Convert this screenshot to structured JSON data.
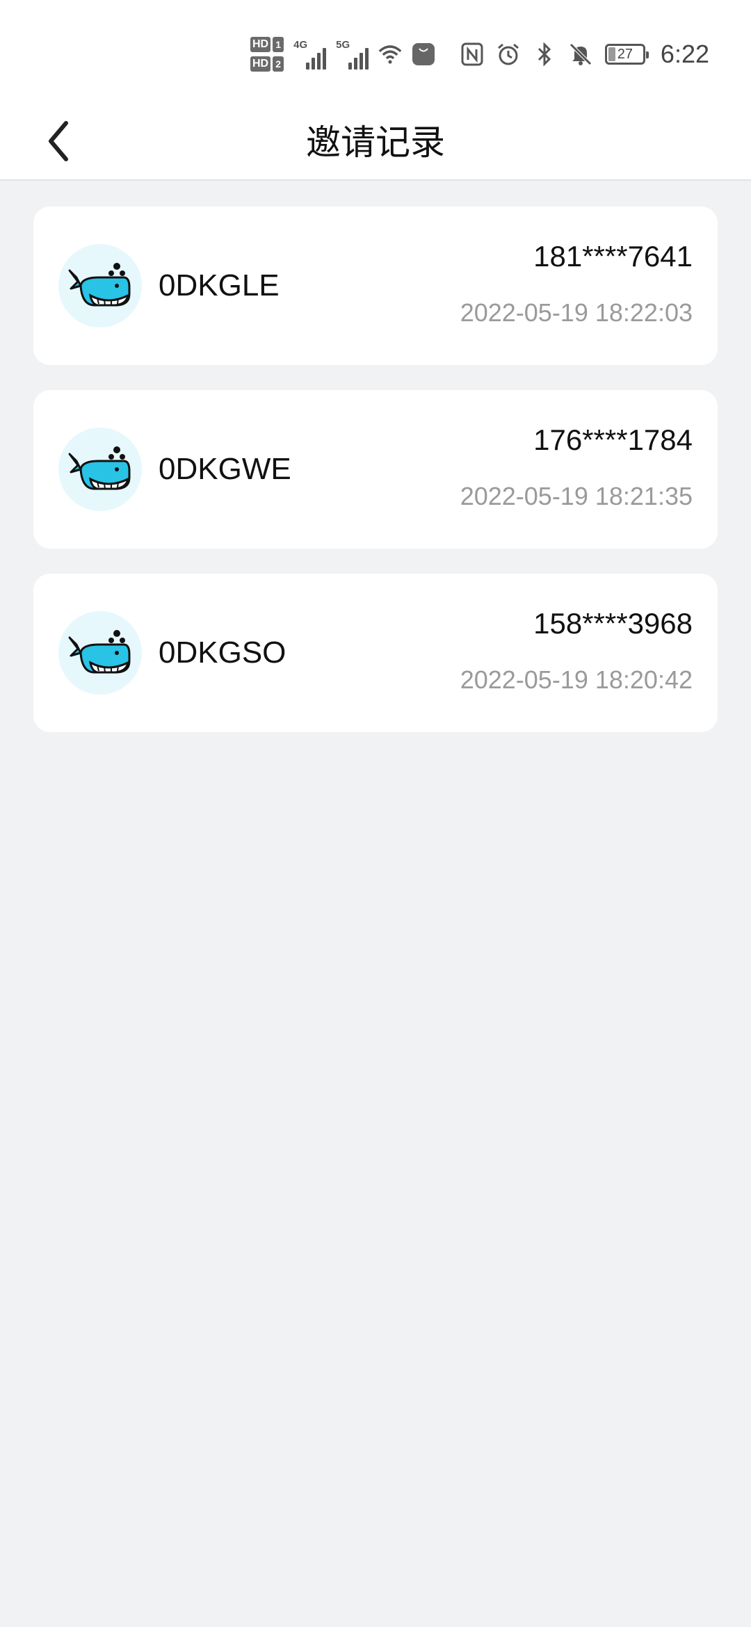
{
  "status_bar": {
    "hd1": "HD",
    "sim1": "1",
    "hd2": "HD",
    "sim2": "2",
    "net1": "4G",
    "net2": "5G",
    "battery": "27",
    "time": "6:22"
  },
  "header": {
    "title": "邀请记录"
  },
  "records": [
    {
      "code": "0DKGLE",
      "phone": "181****7641",
      "time": "2022-05-19 18:22:03"
    },
    {
      "code": "0DKGWE",
      "phone": "176****1784",
      "time": "2022-05-19 18:21:35"
    },
    {
      "code": "0DKGSO",
      "phone": "158****3968",
      "time": "2022-05-19 18:20:42"
    }
  ],
  "colors": {
    "background": "#f1f2f4",
    "card": "#ffffff",
    "whale": "#29c3e6",
    "avatar_bg": "#e6f8fc"
  },
  "icons": {
    "back": "chevron-left-icon",
    "avatar": "whale-icon"
  }
}
